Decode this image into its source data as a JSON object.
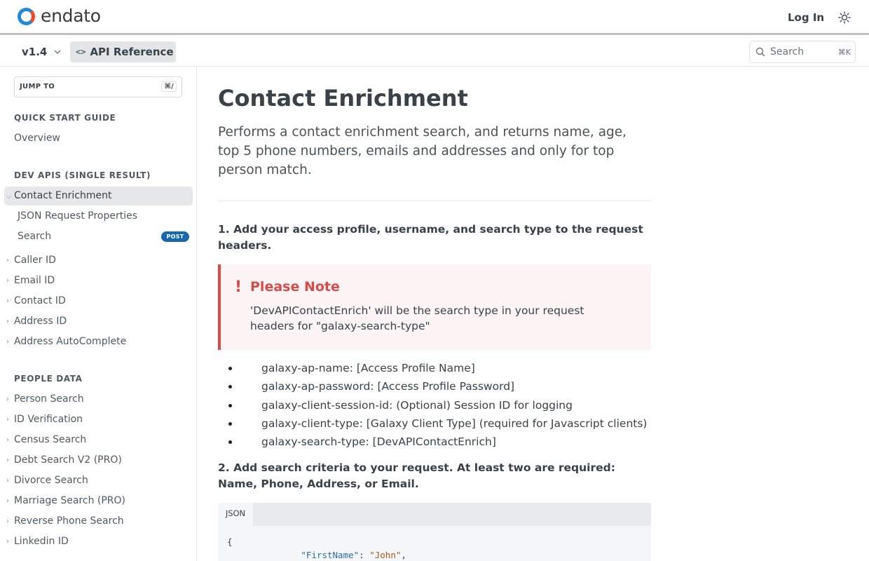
{
  "header": {
    "brand": "endato",
    "login_label": "Log In",
    "theme_icon": "sun-icon"
  },
  "subbar": {
    "version": "v1.4",
    "api_reference_label": "API Reference",
    "search_placeholder": "Search",
    "search_shortcut": "⌘K"
  },
  "sidebar": {
    "jump_to_label": "JUMP TO",
    "jump_to_shortcut": "⌘/",
    "sections": [
      {
        "heading": "QUICK START GUIDE",
        "items": [
          "Overview"
        ]
      },
      {
        "heading": "DEV APIS (SINGLE RESULT)",
        "active": "Contact Enrichment",
        "children": [
          "JSON Request Properties",
          "Search"
        ],
        "search_badge": "POST",
        "items": [
          "Caller ID",
          "Email ID",
          "Contact ID",
          "Address ID",
          "Address AutoComplete"
        ]
      },
      {
        "heading": "PEOPLE DATA",
        "items": [
          "Person Search",
          "ID Verification",
          "Census Search",
          "Debt Search V2 (PRO)",
          "Divorce Search",
          "Marriage Search (PRO)",
          "Reverse Phone Search",
          "Linkedin ID"
        ]
      }
    ]
  },
  "main": {
    "title": "Contact Enrichment",
    "description": "Performs a contact enrichment search, and returns name, age, top 5 phone numbers, emails and addresses and only for top person match.",
    "step1": "1. Add your access profile, username, and search type to the request headers.",
    "note": {
      "title": "Please Note",
      "body": "'DevAPIContactEnrich' will be the search type in your request headers for \"galaxy-search-type\""
    },
    "headers": [
      "galaxy-ap-name: [Access Profile Name]",
      "galaxy-ap-password: [Access Profile Password]",
      "galaxy-client-session-id: (Optional) Session ID for logging",
      "galaxy-client-type: [Galaxy Client Type] (required for Javascript clients)",
      "galaxy-search-type: [DevAPIContactEnrich]"
    ],
    "step2": "2. Add search criteria to your request. At least two are required: Name, Phone, Address, or Email.",
    "code": {
      "tab": "JSON",
      "line1": "{",
      "key1": "\"FirstName\"",
      "val1": "\"John\""
    }
  }
}
